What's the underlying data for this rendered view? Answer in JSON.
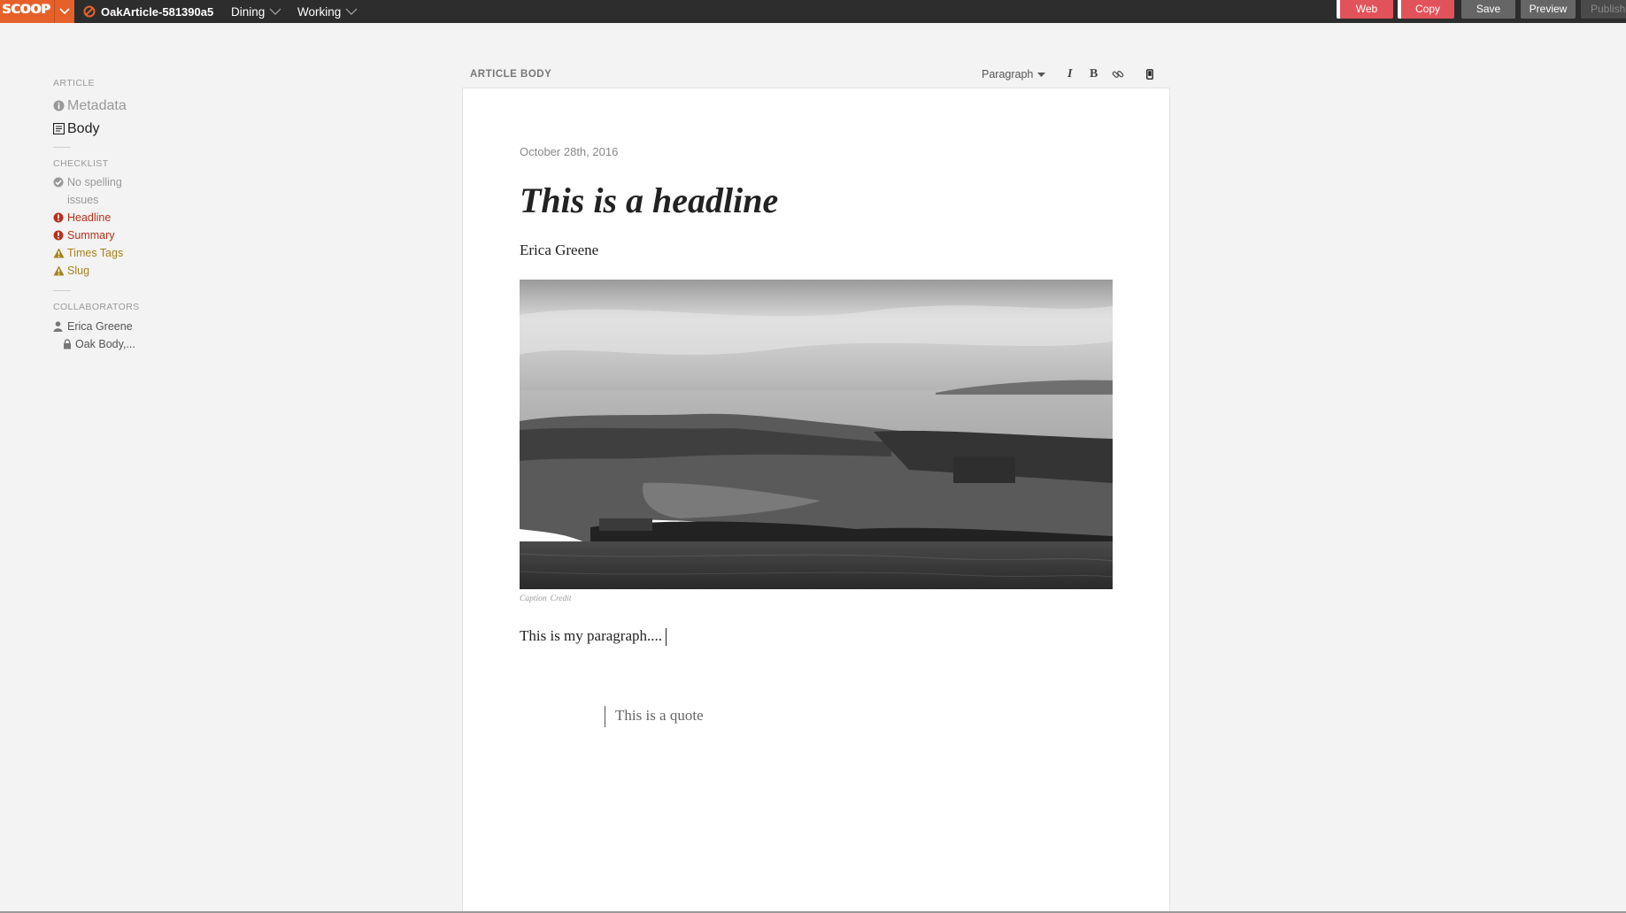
{
  "topbar": {
    "logo_text": "SCOOP",
    "article_id": "OakArticle-581390a5",
    "section_dropdown": "Dining",
    "status_dropdown": "Working",
    "buttons": {
      "web": "Web",
      "copy": "Copy",
      "save": "Save",
      "preview": "Preview",
      "publish": "Publish"
    },
    "colors": {
      "bar": "#2d2d2d",
      "brand": "#e6612a",
      "alert": "#e2525a"
    }
  },
  "sidebar": {
    "article_heading": "ARTICLE",
    "nav": [
      {
        "label": "Metadata",
        "icon": "info-circle-icon"
      },
      {
        "label": "Body",
        "icon": "document-lines-icon"
      }
    ],
    "checklist_heading": "CHECKLIST",
    "checklist": [
      {
        "label": "No spelling issues",
        "status": "ok",
        "icon": "check-circle-icon"
      },
      {
        "label": "Headline",
        "status": "error",
        "icon": "exclamation-circle-icon"
      },
      {
        "label": "Summary",
        "status": "error",
        "icon": "exclamation-circle-icon"
      },
      {
        "label": "Times Tags",
        "status": "warning",
        "icon": "warning-triangle-icon"
      },
      {
        "label": "Slug",
        "status": "warning",
        "icon": "warning-triangle-icon"
      }
    ],
    "collaborators_heading": "COLLABORATORS",
    "collaborators": [
      {
        "name": "Erica Greene",
        "icon": "user-icon"
      },
      {
        "name": "Oak Body,...",
        "icon": "lock-icon"
      }
    ]
  },
  "editor": {
    "panel_label": "ARTICLE BODY",
    "toolbar": {
      "block_type": "Paragraph",
      "italic": "I",
      "bold": "B",
      "link_icon": "link-icon",
      "mobile_icon": "mobile-phone-icon"
    },
    "article": {
      "date": "October 28th, 2016",
      "headline": "This is a headline",
      "byline": "Erica Greene",
      "image": "black-and-white-aerial-photo-of-island-shoreline",
      "caption": "Caption",
      "credit": "Credit",
      "paragraph": "This is my paragraph....",
      "quote": "This is a quote"
    }
  }
}
